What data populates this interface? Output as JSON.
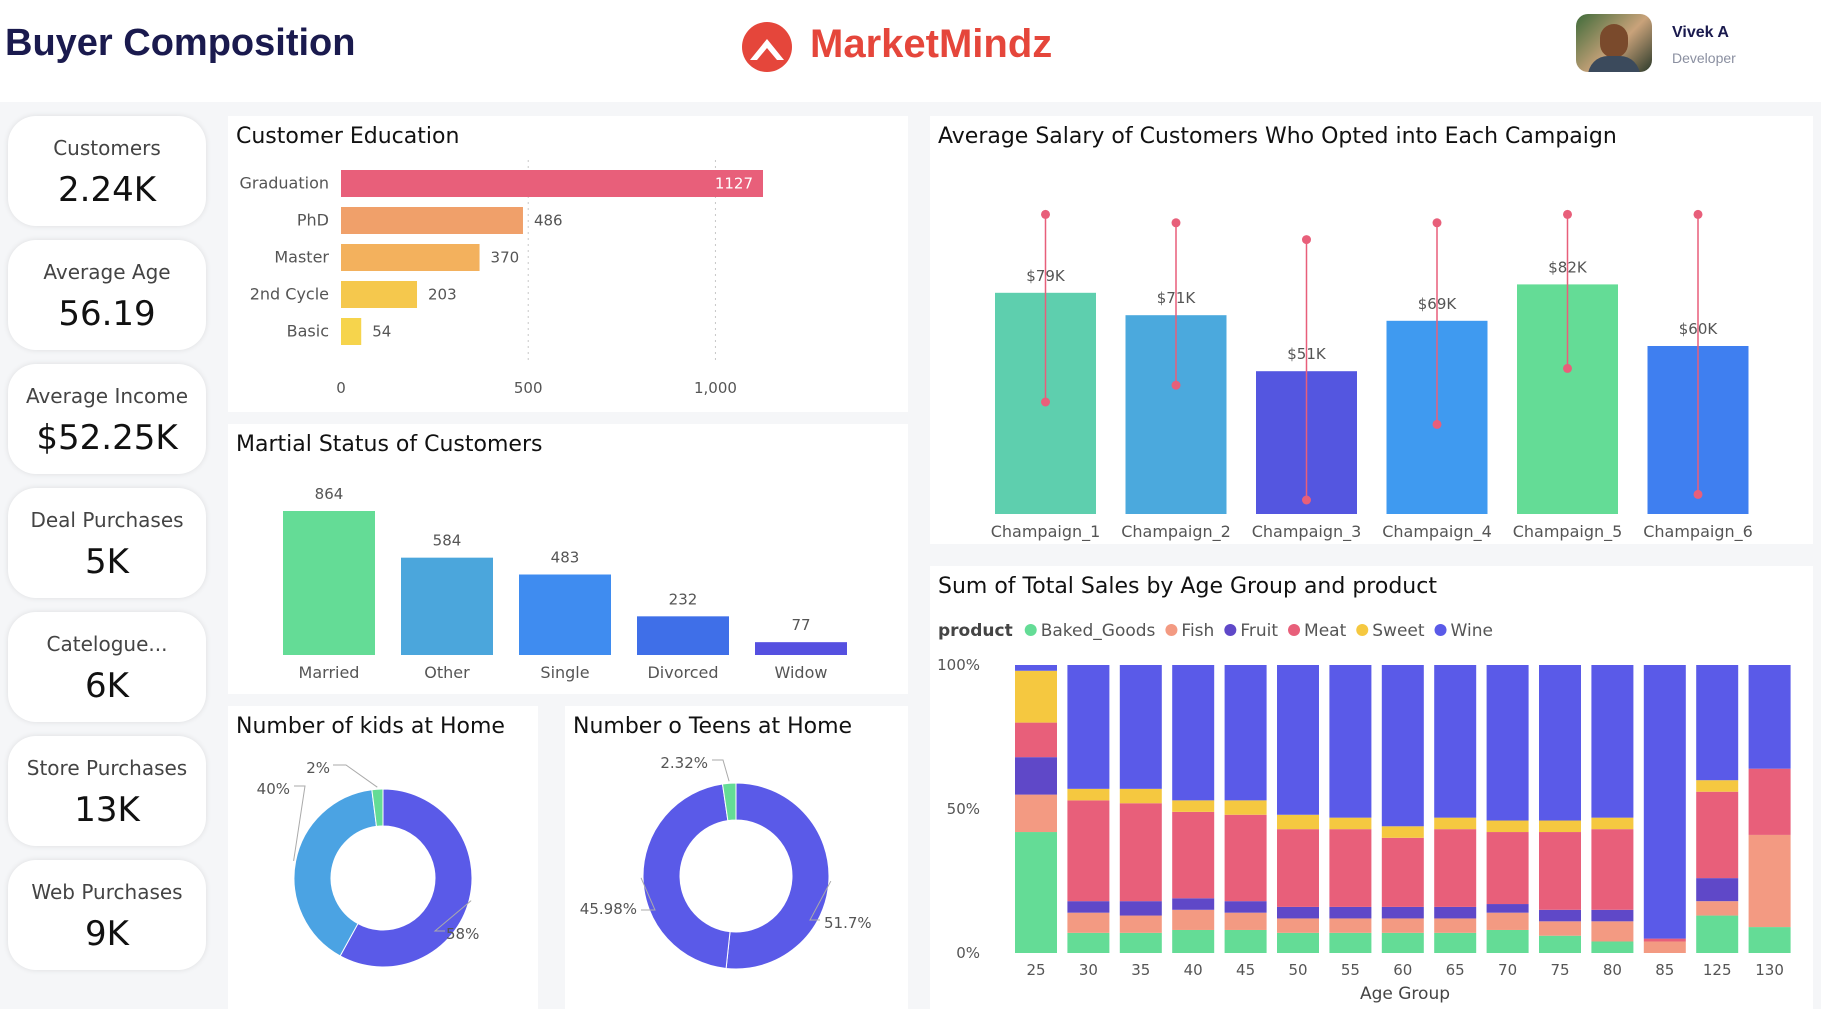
{
  "header": {
    "title": "Buyer Composition",
    "brand": "MarketMindz",
    "user_name": "Vivek A",
    "user_role": "Developer"
  },
  "kpis": [
    {
      "label": "Customers",
      "value": "2.24K"
    },
    {
      "label": "Average Age",
      "value": "56.19"
    },
    {
      "label": "Average Income",
      "value": "$52.25K"
    },
    {
      "label": "Deal Purchases",
      "value": "5K"
    },
    {
      "label": "Catelogue...",
      "value": "6K"
    },
    {
      "label": "Store Purchases",
      "value": "13K"
    },
    {
      "label": "Web Purchases",
      "value": "9K"
    }
  ],
  "chart_data": [
    {
      "type": "bar",
      "orientation": "horizontal",
      "title": "Customer Education",
      "categories": [
        "Graduation",
        "PhD",
        "Master",
        "2nd Cycle",
        "Basic"
      ],
      "values": [
        1127,
        486,
        370,
        203,
        54
      ],
      "value_labels": [
        "1127",
        "486",
        "370",
        "203",
        "54"
      ],
      "colors": [
        "#e85f7a",
        "#f0a06a",
        "#f3b15d",
        "#f5c84d",
        "#f6d44c"
      ],
      "xticks": [
        "0",
        "500",
        "1,000"
      ],
      "xlim": [
        0,
        1127
      ],
      "grid": true
    },
    {
      "type": "bar",
      "title": "Martial Status of Customers",
      "categories": [
        "Married",
        "Other",
        "Single",
        "Divorced",
        "Widow"
      ],
      "values": [
        864,
        584,
        483,
        232,
        77
      ],
      "value_labels": [
        "864",
        "584",
        "483",
        "232",
        "77"
      ],
      "colors": [
        "#64dc96",
        "#4ba6dc",
        "#3f8cf0",
        "#3f6fe8",
        "#5550e0"
      ]
    },
    {
      "type": "pie",
      "title": "Number of kids at Home",
      "slices": [
        {
          "label": "58%",
          "value": 58,
          "color": "#5a5ae8"
        },
        {
          "label": "40%",
          "value": 40,
          "color": "#4ba3e3"
        },
        {
          "label": "2%",
          "value": 2,
          "color": "#64dc96"
        }
      ]
    },
    {
      "type": "pie",
      "title": "Number o Teens at Home",
      "slices": [
        {
          "label": "51.7%",
          "value": 51.7,
          "color": "#5a5ae8"
        },
        {
          "label": "45.98%",
          "value": 45.98,
          "color": "#5a5ae8"
        },
        {
          "label": "2.32%",
          "value": 2.32,
          "color": "#64dc96"
        }
      ]
    },
    {
      "type": "bar",
      "title": "Average Salary of Customers Who Opted into Each Campaign",
      "categories": [
        "Champaign_1",
        "Champaign_2",
        "Champaign_3",
        "Champaign_4",
        "Champaign_5",
        "Champaign_6"
      ],
      "values": [
        79,
        71,
        51,
        69,
        82,
        60
      ],
      "value_labels": [
        "$79K",
        "$71K",
        "$51K",
        "$69K",
        "$82K",
        "$60K"
      ],
      "colors": [
        "#5ecfae",
        "#4ba9dd",
        "#5456e0",
        "#3f9af0",
        "#64dc96",
        "#3f7ff0"
      ],
      "ylim": [
        0,
        110
      ],
      "error_bars": [
        [
          40,
          107
        ],
        [
          46,
          104
        ],
        [
          5,
          98
        ],
        [
          32,
          104
        ],
        [
          52,
          107
        ],
        [
          7,
          107
        ]
      ],
      "error_color": "#e85f7a"
    },
    {
      "type": "bar",
      "stacked": "100%",
      "title": "Sum of Total Sales by Age Group and product",
      "legend_title": "product",
      "legend_position": "top",
      "xlabel": "Age Group",
      "yticks": [
        "0%",
        "50%",
        "100%"
      ],
      "ylim": [
        0,
        100
      ],
      "categories": [
        "25",
        "30",
        "35",
        "40",
        "45",
        "50",
        "55",
        "60",
        "65",
        "70",
        "75",
        "80",
        "85",
        "125",
        "130"
      ],
      "series": [
        {
          "name": "Baked_Goods",
          "color": "#64dc96",
          "values": [
            42,
            7,
            7,
            8,
            8,
            7,
            7,
            7,
            7,
            8,
            6,
            4,
            0,
            13,
            9
          ]
        },
        {
          "name": "Fish",
          "color": "#f39a82",
          "values": [
            13,
            7,
            6,
            7,
            6,
            5,
            5,
            5,
            5,
            6,
            5,
            7,
            4,
            5,
            32
          ]
        },
        {
          "name": "Fruit",
          "color": "#5f48c8",
          "values": [
            13,
            4,
            5,
            4,
            4,
            4,
            4,
            4,
            4,
            3,
            4,
            4,
            0,
            8,
            0
          ]
        },
        {
          "name": "Meat",
          "color": "#e85f7a",
          "values": [
            12,
            35,
            34,
            30,
            30,
            27,
            27,
            24,
            27,
            25,
            27,
            28,
            1,
            30,
            23
          ]
        },
        {
          "name": "Sweet",
          "color": "#f5c840",
          "values": [
            18,
            4,
            5,
            4,
            5,
            5,
            4,
            4,
            4,
            4,
            4,
            4,
            0,
            4,
            0
          ]
        },
        {
          "name": "Wine",
          "color": "#5a5ae8",
          "values": [
            2,
            43,
            43,
            47,
            47,
            52,
            53,
            56,
            53,
            54,
            54,
            53,
            95,
            40,
            36
          ]
        }
      ]
    }
  ]
}
